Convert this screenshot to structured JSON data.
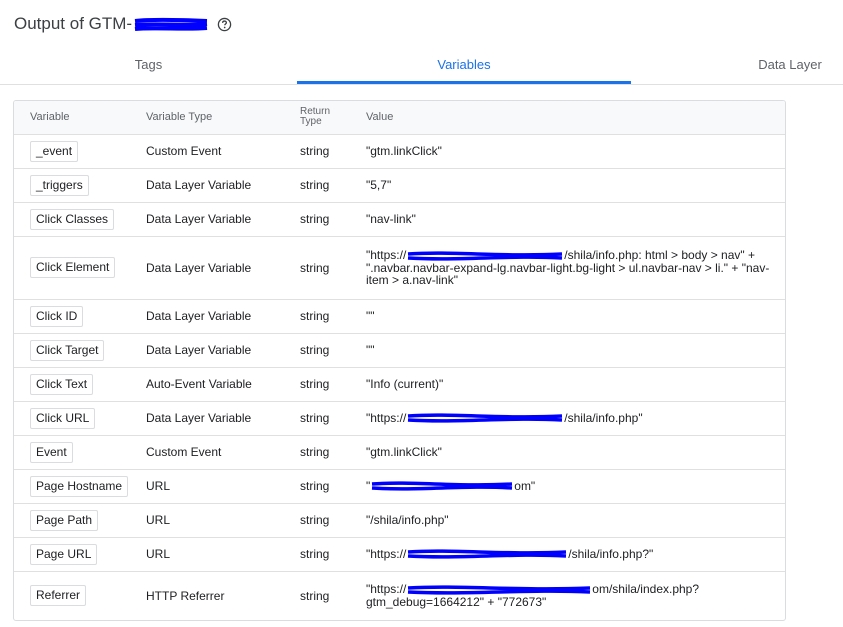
{
  "header": {
    "title": "Output of GTM-"
  },
  "tabs": [
    {
      "label": "Tags"
    },
    {
      "label": "Variables"
    },
    {
      "label": "Data Layer"
    }
  ],
  "table": {
    "headers": {
      "variable": "Variable",
      "type": "Variable Type",
      "return_line1": "Return",
      "return_line2": "Type",
      "value": "Value"
    },
    "rows": [
      {
        "name": "_event",
        "type": "Custom Event",
        "ret": "string",
        "value": "\"gtm.linkClick\""
      },
      {
        "name": "_triggers",
        "type": "Data Layer Variable",
        "ret": "string",
        "value": "\"5,7\""
      },
      {
        "name": "Click Classes",
        "type": "Data Layer Variable",
        "ret": "string",
        "value": "\"nav-link\""
      },
      {
        "name": "Click Element",
        "type": "Data Layer Variable",
        "ret": "string",
        "value_pre": "\"https://",
        "value_post": "/shila/info.php: html > body > nav\" + \".navbar.navbar-expand-lg.navbar-light.bg-light > ul.navbar-nav > li.\" + \"nav-item > a.nav-link\""
      },
      {
        "name": "Click ID",
        "type": "Data Layer Variable",
        "ret": "string",
        "value": "\"\""
      },
      {
        "name": "Click Target",
        "type": "Data Layer Variable",
        "ret": "string",
        "value": "\"\""
      },
      {
        "name": "Click Text",
        "type": "Auto-Event Variable",
        "ret": "string",
        "value": "\"Info (current)\""
      },
      {
        "name": "Click URL",
        "type": "Data Layer Variable",
        "ret": "string",
        "value_pre": "\"https://",
        "value_post": "/shila/info.php\""
      },
      {
        "name": "Event",
        "type": "Custom Event",
        "ret": "string",
        "value": "\"gtm.linkClick\""
      },
      {
        "name": "Page Hostname",
        "type": "URL",
        "ret": "string",
        "value_pre": "\"",
        "value_post": "om\""
      },
      {
        "name": "Page Path",
        "type": "URL",
        "ret": "string",
        "value": "\"/shila/info.php\""
      },
      {
        "name": "Page URL",
        "type": "URL",
        "ret": "string",
        "value_pre": "\"https://",
        "value_post": "/shila/info.php?\""
      },
      {
        "name": "Referrer",
        "type": "HTTP Referrer",
        "ret": "string",
        "value_pre": "\"https://",
        "value_post": "om/shila/index.php? gtm_debug=1664212\" + \"772673\""
      }
    ]
  },
  "colors": {
    "accent": "#1a73e8",
    "redaction": "#0000ff"
  }
}
